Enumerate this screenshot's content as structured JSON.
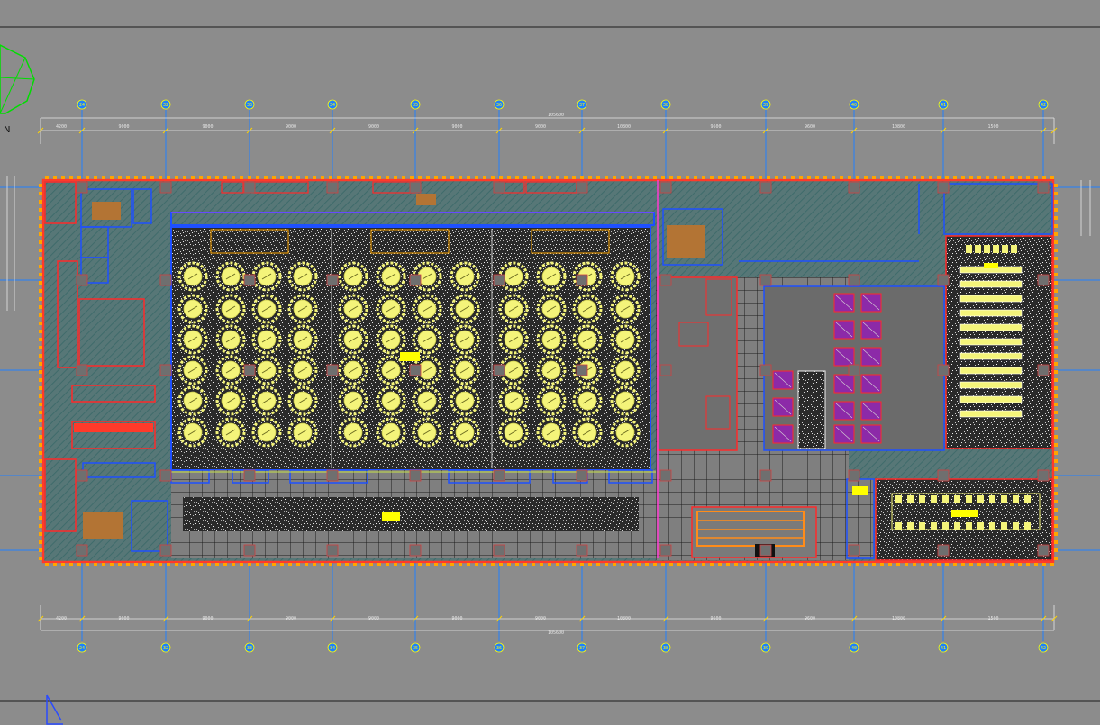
{
  "north_label": "N",
  "grid_labels_top": [
    "24",
    "32",
    "33",
    "34",
    "35",
    "36",
    "37",
    "38",
    "39",
    "40",
    "41",
    "42"
  ],
  "grid_labels_bottom": [
    "24",
    "32",
    "33",
    "34",
    "35",
    "36",
    "37",
    "38",
    "39",
    "40",
    "41",
    "42"
  ],
  "overall_dimension": "105600",
  "dimension_values": [
    "4200",
    "9000",
    "9000",
    "9000",
    "9000",
    "9000",
    "9000",
    "10800",
    "9600",
    "9600",
    "10800",
    "1500"
  ],
  "colors": {
    "background": "#8c8c8c",
    "wall_red": "#ff2a2a",
    "wall_blue": "#1e50ff",
    "grid_blue": "#1f7fff",
    "column_orange": "#ffa500",
    "table_yellow": "#f4f47a",
    "hatch_teal": "#3d7474",
    "line_white": "#f2f2f2"
  },
  "icons": {
    "north_arrow": "north-arrow-icon",
    "ucs": "ucs-icon"
  }
}
